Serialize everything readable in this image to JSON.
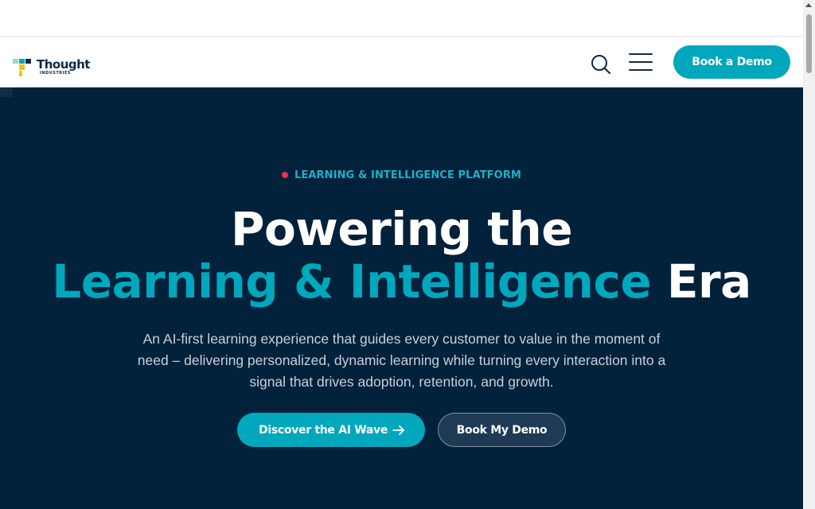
{
  "header": {
    "logo_text": "Thought",
    "logo_subtext": "INDUSTRIES",
    "search_icon": "search-icon",
    "menu_icon": "hamburger-menu-icon",
    "demo_label": "Book a Demo"
  },
  "hero": {
    "eyebrow": "LEARNING & INTELLIGENCE PLATFORM",
    "headline_line1": "Powering the",
    "headline_accent": "Learning & Intelligence",
    "headline_end": "Era",
    "subtext": "An AI-first learning experience that guides every customer to value in the moment of need – delivering personalized, dynamic learning while turning every interaction into a signal that drives adoption, retention, and growth.",
    "cta_primary": "Discover the AI Wave",
    "cta_primary_icon": "arrow-right-icon",
    "cta_secondary": "Book My Demo"
  },
  "colors": {
    "brand_teal": "#00a7bd",
    "hero_bg": "#02213b",
    "accent_dot": "#e8305f",
    "navy": "#0f2a44"
  }
}
